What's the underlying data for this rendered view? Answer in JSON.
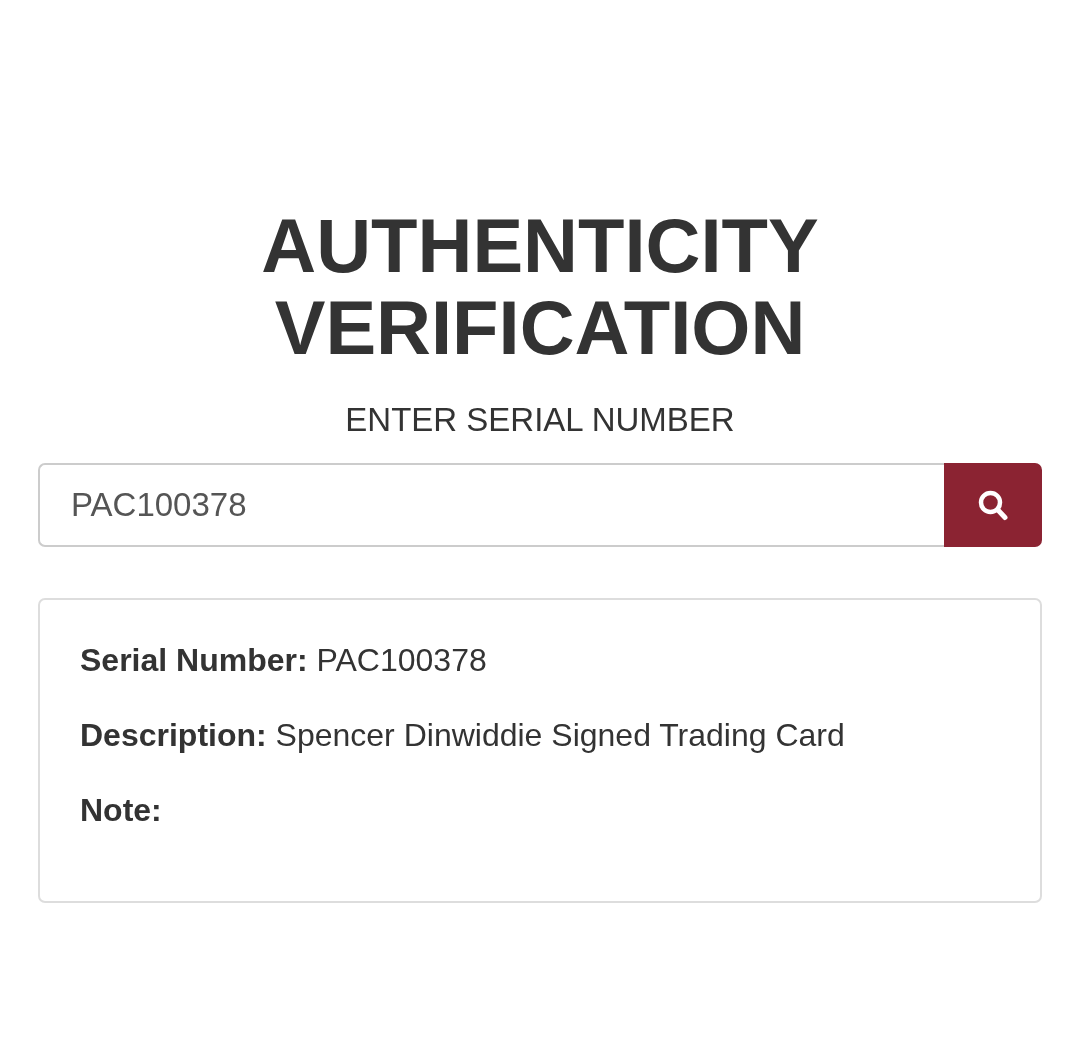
{
  "heading": {
    "title": "AUTHENTICITY VERIFICATION",
    "subtitle": "ENTER SERIAL NUMBER"
  },
  "search": {
    "value": "PAC100378"
  },
  "details": [
    {
      "label": "Serial Number:",
      "value": "PAC100378"
    },
    {
      "label": "Description:",
      "value": "Spencer Dinwiddie Signed Trading Card"
    },
    {
      "label": "Note:"
    }
  ]
}
